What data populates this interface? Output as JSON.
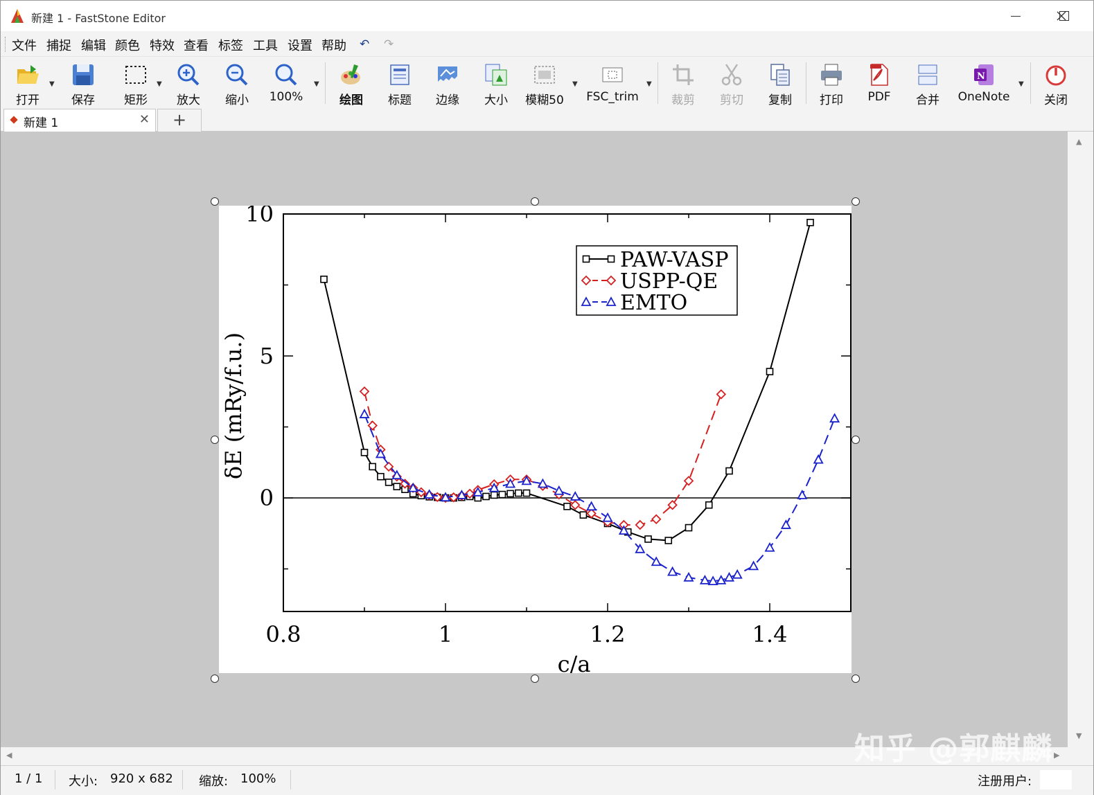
{
  "window": {
    "title": "新建 1 - FastStone Editor",
    "controls": {
      "minimize": "—",
      "maximize": "☐",
      "close": "✕"
    }
  },
  "menu": [
    "文件",
    "捕捉",
    "编辑",
    "颜色",
    "特效",
    "查看",
    "标签",
    "工具",
    "设置",
    "帮助"
  ],
  "toolbar": {
    "open": "打开",
    "save": "保存",
    "rect": "矩形",
    "zoom_in": "放大",
    "zoom_out": "缩小",
    "zoom_100": "100%",
    "draw": "绘图",
    "caption": "标题",
    "edge": "边缘",
    "resize": "大小",
    "blur": "模糊50",
    "fsc_trim": "FSC_trim",
    "crop": "裁剪",
    "cut": "剪切",
    "copy": "复制",
    "print": "打印",
    "pdf": "PDF",
    "merge": "合并",
    "onenote": "OneNote",
    "close": "关闭"
  },
  "tabs": {
    "active": "新建 1",
    "new": "+"
  },
  "status": {
    "page": "1 / 1",
    "size_label": "大小:",
    "size": "920 x 682",
    "zoom_label": "缩放:",
    "zoom": "100%",
    "registered": "注册用户:"
  },
  "watermark": "知乎 @郭麒麟",
  "chart_data": {
    "type": "line",
    "xlabel": "c/a",
    "ylabel": "δE (mRy/f.u.)",
    "xlim": [
      0.8,
      1.5
    ],
    "ylim": [
      -4,
      10
    ],
    "xticks": [
      "0.8",
      "1",
      "1.2",
      "1.4"
    ],
    "yticks": [
      "0",
      "5",
      "10"
    ],
    "legend_position": "top-right",
    "series": [
      {
        "name": "PAW-VASP",
        "color": "#000000",
        "marker": "square",
        "dash": false,
        "x": [
          0.85,
          0.9,
          0.91,
          0.92,
          0.93,
          0.94,
          0.95,
          0.96,
          0.97,
          0.98,
          0.99,
          1.0,
          1.01,
          1.02,
          1.03,
          1.04,
          1.05,
          1.06,
          1.07,
          1.08,
          1.09,
          1.1,
          1.15,
          1.17,
          1.2,
          1.225,
          1.25,
          1.275,
          1.3,
          1.325,
          1.35,
          1.4,
          1.45
        ],
        "y": [
          7.7,
          1.6,
          1.1,
          0.75,
          0.55,
          0.4,
          0.3,
          0.15,
          0.08,
          0.04,
          0.02,
          0.0,
          0.0,
          0.02,
          0.05,
          0.0,
          0.05,
          0.1,
          0.12,
          0.15,
          0.17,
          0.17,
          -0.3,
          -0.6,
          -0.9,
          -1.2,
          -1.45,
          -1.5,
          -1.05,
          -0.25,
          0.95,
          4.45,
          9.7
        ]
      },
      {
        "name": "USPP-QE",
        "color": "#d62020",
        "marker": "diamond",
        "dash": true,
        "x": [
          0.9,
          0.91,
          0.92,
          0.93,
          0.94,
          0.95,
          0.96,
          0.97,
          0.98,
          0.99,
          1.0,
          1.01,
          1.02,
          1.03,
          1.04,
          1.06,
          1.08,
          1.1,
          1.12,
          1.14,
          1.16,
          1.18,
          1.2,
          1.22,
          1.24,
          1.26,
          1.28,
          1.3,
          1.34
        ],
        "y": [
          3.75,
          2.55,
          1.7,
          1.1,
          0.75,
          0.5,
          0.35,
          0.2,
          0.1,
          0.03,
          0.0,
          0.02,
          0.08,
          0.15,
          0.28,
          0.48,
          0.65,
          0.65,
          0.42,
          0.12,
          -0.25,
          -0.55,
          -0.85,
          -0.95,
          -0.95,
          -0.75,
          -0.25,
          0.6,
          3.65
        ]
      },
      {
        "name": "EMTO",
        "color": "#1a22cc",
        "marker": "triangle",
        "dash": true,
        "x": [
          0.9,
          0.92,
          0.94,
          0.96,
          0.98,
          1.0,
          1.02,
          1.04,
          1.06,
          1.08,
          1.1,
          1.12,
          1.14,
          1.16,
          1.18,
          1.2,
          1.22,
          1.24,
          1.26,
          1.28,
          1.3,
          1.32,
          1.33,
          1.34,
          1.35,
          1.36,
          1.38,
          1.4,
          1.42,
          1.44,
          1.46,
          1.48
        ],
        "y": [
          2.95,
          1.55,
          0.8,
          0.35,
          0.12,
          0.02,
          0.1,
          0.2,
          0.35,
          0.5,
          0.6,
          0.5,
          0.25,
          0.05,
          -0.3,
          -0.7,
          -1.15,
          -1.8,
          -2.25,
          -2.6,
          -2.8,
          -2.9,
          -2.93,
          -2.9,
          -2.8,
          -2.7,
          -2.4,
          -1.75,
          -0.95,
          0.1,
          1.35,
          2.8
        ]
      }
    ]
  }
}
